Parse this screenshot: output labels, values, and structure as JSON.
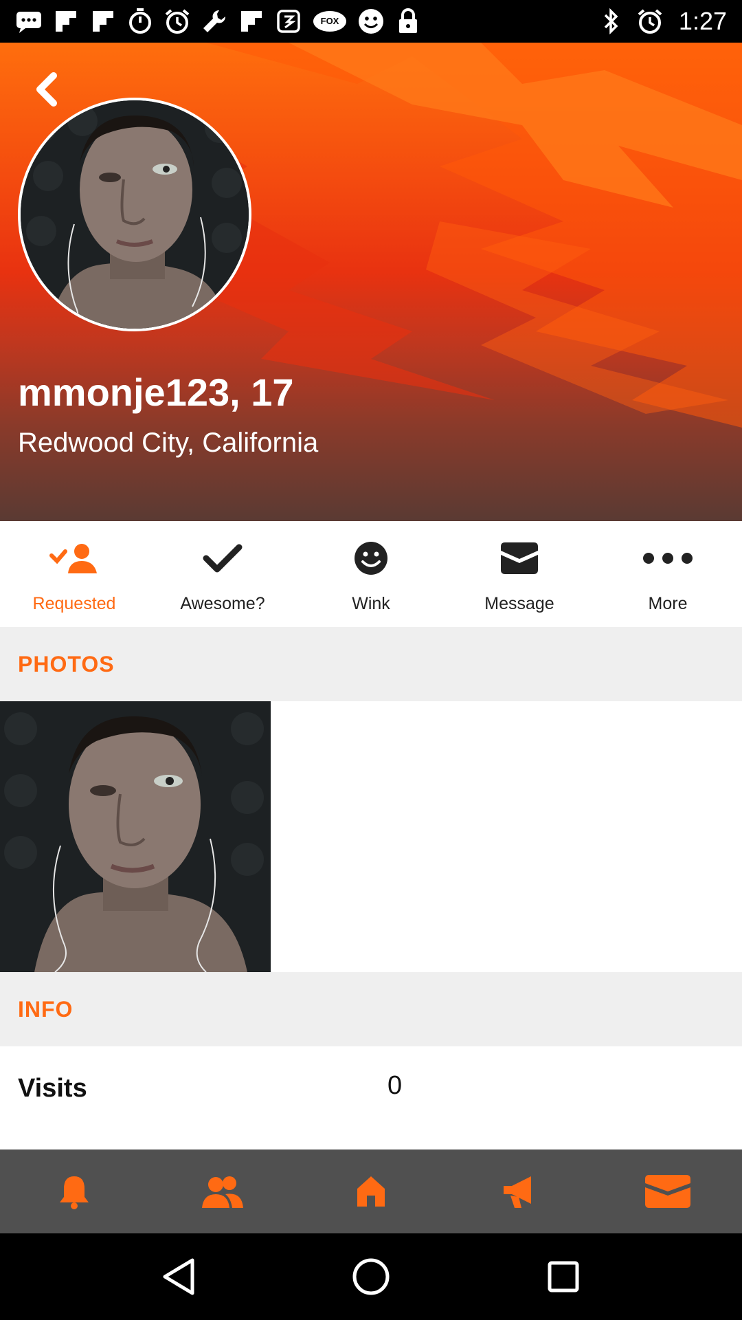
{
  "status_bar": {
    "time": "1:27",
    "icons": [
      "chat-icon",
      "flipboard-icon",
      "flipboard-icon",
      "timer-icon",
      "alarm-icon",
      "wrench-icon",
      "flipboard-icon",
      "app-icon",
      "fox-sports-icon",
      "smiley-icon",
      "lock-icon",
      "bluetooth-icon",
      "alarm-icon"
    ],
    "fox_label": "FOX"
  },
  "profile": {
    "name_age": "mmonje123, 17",
    "location": "Redwood City, California"
  },
  "actions": [
    {
      "label": "Requested",
      "icon": "requested-icon",
      "active": true
    },
    {
      "label": "Awesome?",
      "icon": "checkmark-icon",
      "active": false
    },
    {
      "label": "Wink",
      "icon": "wink-smiley-icon",
      "active": false
    },
    {
      "label": "Message",
      "icon": "envelope-icon",
      "active": false
    },
    {
      "label": "More",
      "icon": "more-dots-icon",
      "active": false
    }
  ],
  "sections": {
    "photos": "PHOTOS",
    "info": "INFO"
  },
  "info": {
    "visits_label": "Visits",
    "visits_value": "0"
  },
  "tabbar": [
    "bell-icon",
    "people-icon",
    "home-icon",
    "megaphone-icon",
    "inbox-icon"
  ],
  "colors": {
    "accent": "#ff6a13",
    "tabbar_bg": "#505050",
    "section_bg": "#efefef"
  }
}
